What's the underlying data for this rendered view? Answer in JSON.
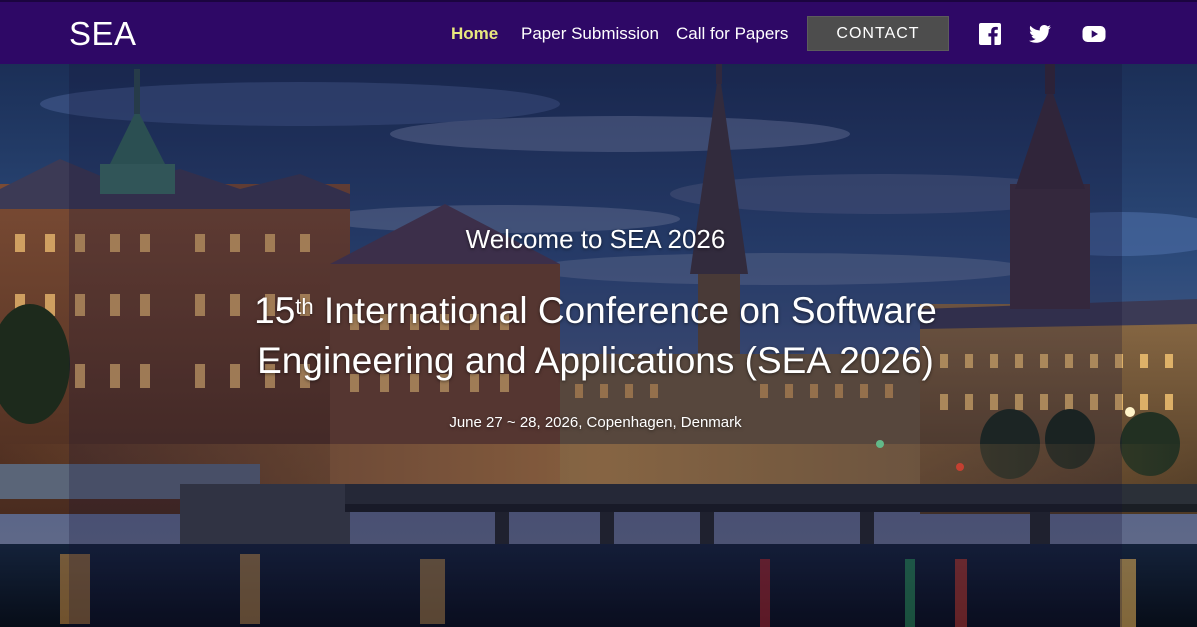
{
  "brand": "SEA",
  "nav": {
    "items": [
      {
        "label": "Home",
        "active": true
      },
      {
        "label": "Paper Submission",
        "active": false
      },
      {
        "label": "Call for Papers",
        "active": false
      }
    ],
    "contact_label": "CONTACT",
    "social": [
      "facebook-icon",
      "twitter-icon",
      "youtube-icon"
    ]
  },
  "hero": {
    "welcome": "Welcome to SEA 2026",
    "ordinal_number": "15",
    "ordinal_suffix": "th",
    "title_line1_rest": " International Conference on Software",
    "title_line2": "Engineering and Applications (SEA 2026)",
    "dates": "June 27 ~ 28, 2026, Copenhagen, Denmark"
  },
  "colors": {
    "navbar": "#2e0866",
    "active_link": "#e9e87e",
    "contact_button": "#4d4d4d"
  }
}
